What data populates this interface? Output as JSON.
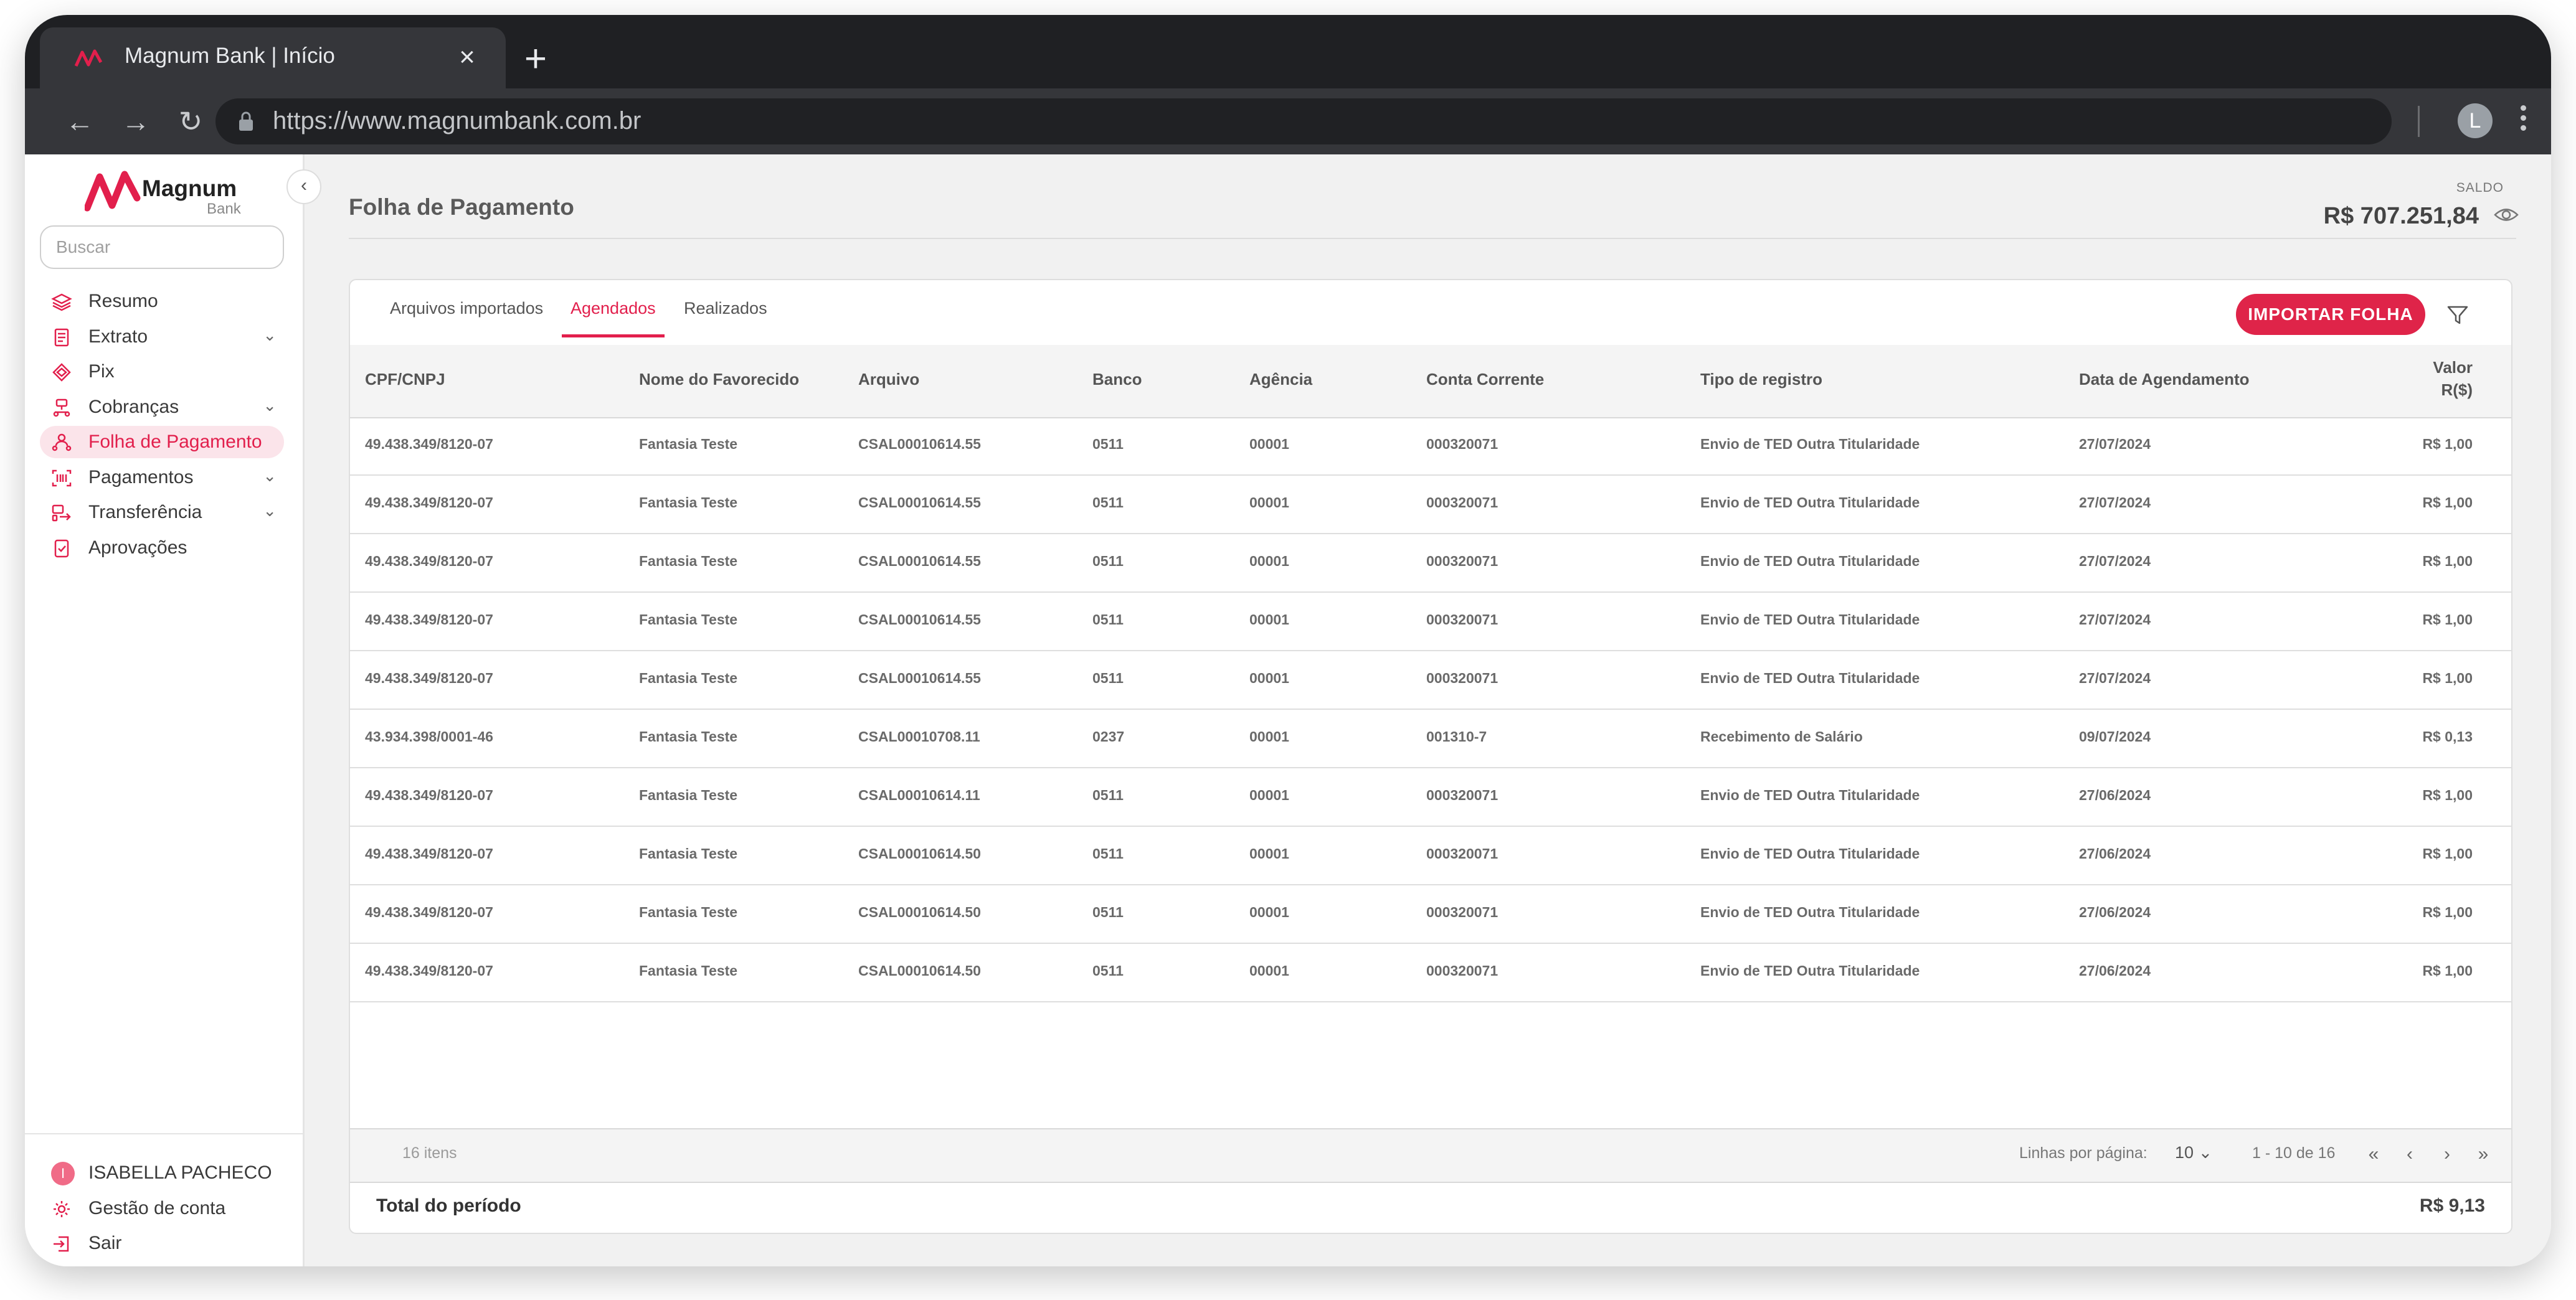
{
  "browser": {
    "tab_title": "Magnum Bank  |  Início",
    "url": "https://www.magnumbank.com.br",
    "profile_initial": "L"
  },
  "brand": {
    "name": "Magnum",
    "sub": "Bank",
    "accent": "#e21f4c"
  },
  "sidebar": {
    "search_placeholder": "Buscar",
    "items": [
      {
        "label": "Resumo",
        "icon": "layers-icon",
        "has_children": false,
        "active": false
      },
      {
        "label": "Extrato",
        "icon": "document-list-icon",
        "has_children": true,
        "active": false
      },
      {
        "label": "Pix",
        "icon": "pix-icon",
        "has_children": false,
        "active": false
      },
      {
        "label": "Cobranças",
        "icon": "billing-icon",
        "has_children": true,
        "active": false
      },
      {
        "label": "Folha de Pagamento",
        "icon": "payroll-icon",
        "has_children": false,
        "active": true
      },
      {
        "label": "Pagamentos",
        "icon": "barcode-icon",
        "has_children": true,
        "active": false
      },
      {
        "label": "Transferência",
        "icon": "transfer-icon",
        "has_children": true,
        "active": false
      },
      {
        "label": "Aprovações",
        "icon": "approval-icon",
        "has_children": false,
        "active": false
      }
    ],
    "bottom": {
      "user_initial": "I",
      "user_name": "ISABELLA PACHECO",
      "account": "Gestão de conta",
      "logout": "Sair"
    },
    "chevron": "⌄"
  },
  "header": {
    "title": "Folha de Pagamento",
    "saldo_label": "SALDO",
    "saldo_value": "R$ 707.251,84"
  },
  "tabs": [
    {
      "label": "Arquivos importados",
      "active": false
    },
    {
      "label": "Agendados",
      "active": true
    },
    {
      "label": "Realizados",
      "active": false
    }
  ],
  "import_button": "IMPORTAR FOLHA",
  "table": {
    "columns": [
      "CPF/CNPJ",
      "Nome do Favorecido",
      "Arquivo",
      "Banco",
      "Agência",
      "Conta Corrente",
      "Tipo de registro",
      "Data de Agendamento"
    ],
    "valor_header": [
      "Valor",
      "R($)"
    ],
    "rows": [
      [
        "49.438.349/8120-07",
        "Fantasia Teste",
        "CSAL00010614.55",
        "0511",
        "00001",
        "000320071",
        "Envio de TED Outra Titularidade",
        "27/07/2024",
        "R$ 1,00"
      ],
      [
        "49.438.349/8120-07",
        "Fantasia Teste",
        "CSAL00010614.55",
        "0511",
        "00001",
        "000320071",
        "Envio de TED Outra Titularidade",
        "27/07/2024",
        "R$ 1,00"
      ],
      [
        "49.438.349/8120-07",
        "Fantasia Teste",
        "CSAL00010614.55",
        "0511",
        "00001",
        "000320071",
        "Envio de TED Outra Titularidade",
        "27/07/2024",
        "R$ 1,00"
      ],
      [
        "49.438.349/8120-07",
        "Fantasia Teste",
        "CSAL00010614.55",
        "0511",
        "00001",
        "000320071",
        "Envio de TED Outra Titularidade",
        "27/07/2024",
        "R$ 1,00"
      ],
      [
        "49.438.349/8120-07",
        "Fantasia Teste",
        "CSAL00010614.55",
        "0511",
        "00001",
        "000320071",
        "Envio de TED Outra Titularidade",
        "27/07/2024",
        "R$ 1,00"
      ],
      [
        "43.934.398/0001-46",
        "Fantasia Teste",
        "CSAL00010708.11",
        "0237",
        "00001",
        "001310-7",
        "Recebimento de Salário",
        "09/07/2024",
        "R$ 0,13"
      ],
      [
        "49.438.349/8120-07",
        "Fantasia Teste",
        "CSAL00010614.11",
        "0511",
        "00001",
        "000320071",
        "Envio de TED Outra Titularidade",
        "27/06/2024",
        "R$ 1,00"
      ],
      [
        "49.438.349/8120-07",
        "Fantasia Teste",
        "CSAL00010614.50",
        "0511",
        "00001",
        "000320071",
        "Envio de TED Outra Titularidade",
        "27/06/2024",
        "R$ 1,00"
      ],
      [
        "49.438.349/8120-07",
        "Fantasia Teste",
        "CSAL00010614.50",
        "0511",
        "00001",
        "000320071",
        "Envio de TED Outra Titularidade",
        "27/06/2024",
        "R$ 1,00"
      ],
      [
        "49.438.349/8120-07",
        "Fantasia Teste",
        "CSAL00010614.50",
        "0511",
        "00001",
        "000320071",
        "Envio de TED Outra Titularidade",
        "27/06/2024",
        "R$ 1,00"
      ]
    ]
  },
  "footer": {
    "items_count": "16 itens",
    "rows_per_page_label": "Linhas por página:",
    "rows_per_page_value": "10",
    "range": "1 - 10 de 16",
    "pager": {
      "first": "«",
      "prev": "‹",
      "next": "›",
      "last": "»"
    },
    "total_label": "Total do período",
    "total_value": "R$ 9,13"
  }
}
